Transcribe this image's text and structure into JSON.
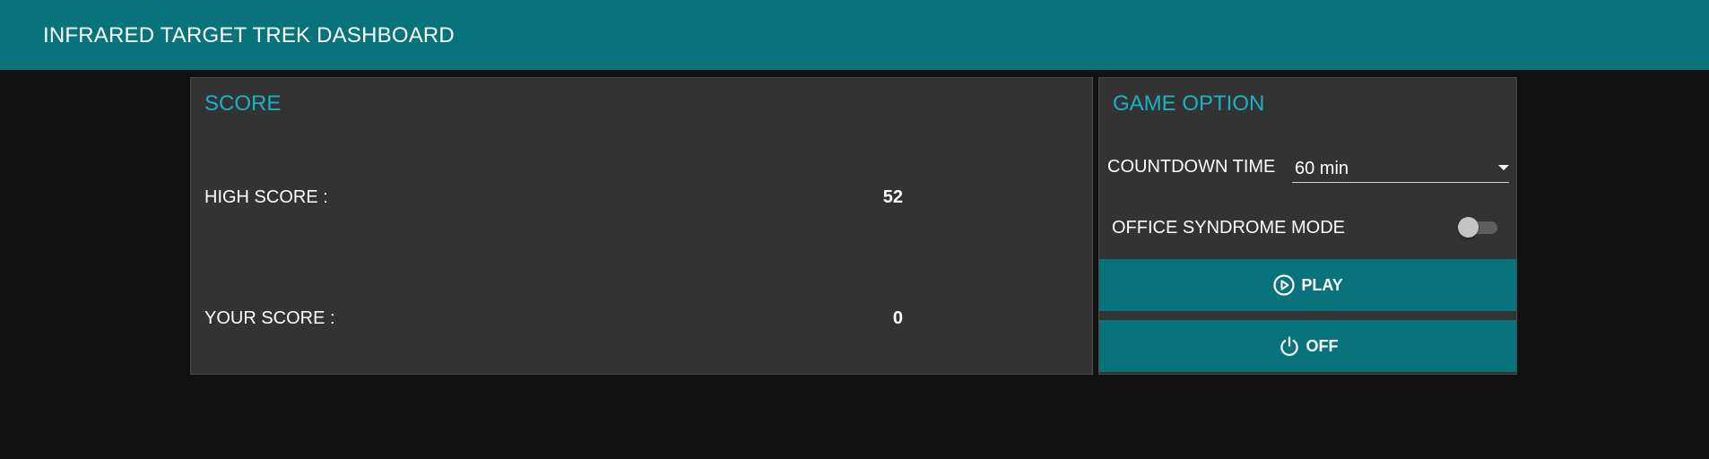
{
  "header": {
    "title": "INFRARED TARGET TREK DASHBOARD",
    "background": "#08737a"
  },
  "score": {
    "title": "SCORE",
    "high_score_label": "HIGH SCORE :",
    "high_score_value": "52",
    "your_score_label": "YOUR SCORE :",
    "your_score_value": "0"
  },
  "options": {
    "title": "GAME OPTION",
    "countdown_label": "COUNTDOWN TIME",
    "countdown_value": "60 min",
    "office_mode_label": "OFFICE SYNDROME MODE",
    "office_mode_on": false,
    "play_label": "PLAY",
    "play_icon": "play-circle-icon",
    "off_label": "OFF",
    "off_icon": "power-icon"
  },
  "colors": {
    "accent": "#19b2c2",
    "button": "#08737a",
    "card": "#333333",
    "page": "#121212"
  }
}
